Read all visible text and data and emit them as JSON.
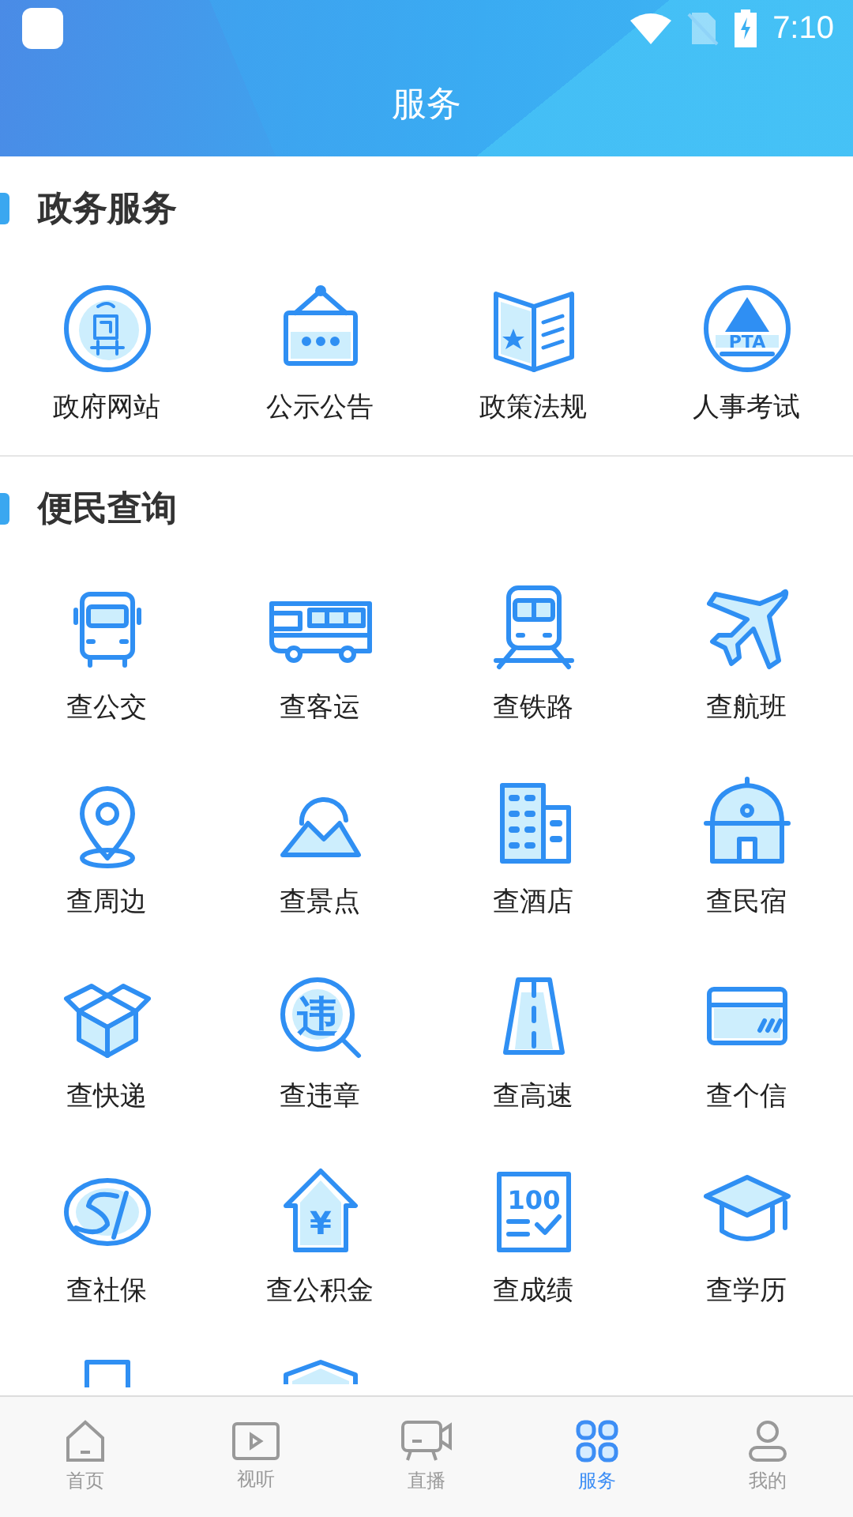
{
  "status_bar": {
    "time": "7:10"
  },
  "header": {
    "title": "服务"
  },
  "sections": [
    {
      "title": "政务服务",
      "items": [
        {
          "label": "政府网站"
        },
        {
          "label": "公示公告"
        },
        {
          "label": "政策法规"
        },
        {
          "label": "人事考试",
          "icon_text": "PTA"
        }
      ]
    },
    {
      "title": "便民查询",
      "items": [
        {
          "label": "查公交"
        },
        {
          "label": "查客运"
        },
        {
          "label": "查铁路"
        },
        {
          "label": "查航班"
        },
        {
          "label": "查周边"
        },
        {
          "label": "查景点"
        },
        {
          "label": "查酒店"
        },
        {
          "label": "查民宿"
        },
        {
          "label": "查快递"
        },
        {
          "label": "查违章",
          "icon_text": "违"
        },
        {
          "label": "查高速"
        },
        {
          "label": "查个信"
        },
        {
          "label": "查社保"
        },
        {
          "label": "查公积金",
          "icon_text": "¥"
        },
        {
          "label": "查成绩",
          "icon_text": "100"
        },
        {
          "label": "查学历"
        },
        {
          "cut_off": true
        },
        {
          "cut_off": true
        }
      ]
    }
  ],
  "tabs": [
    {
      "label": "首页",
      "selected": false
    },
    {
      "label": "视听",
      "selected": false
    },
    {
      "label": "直播",
      "selected": false
    },
    {
      "label": "服务",
      "selected": true
    },
    {
      "label": "我的",
      "selected": false
    }
  ]
}
